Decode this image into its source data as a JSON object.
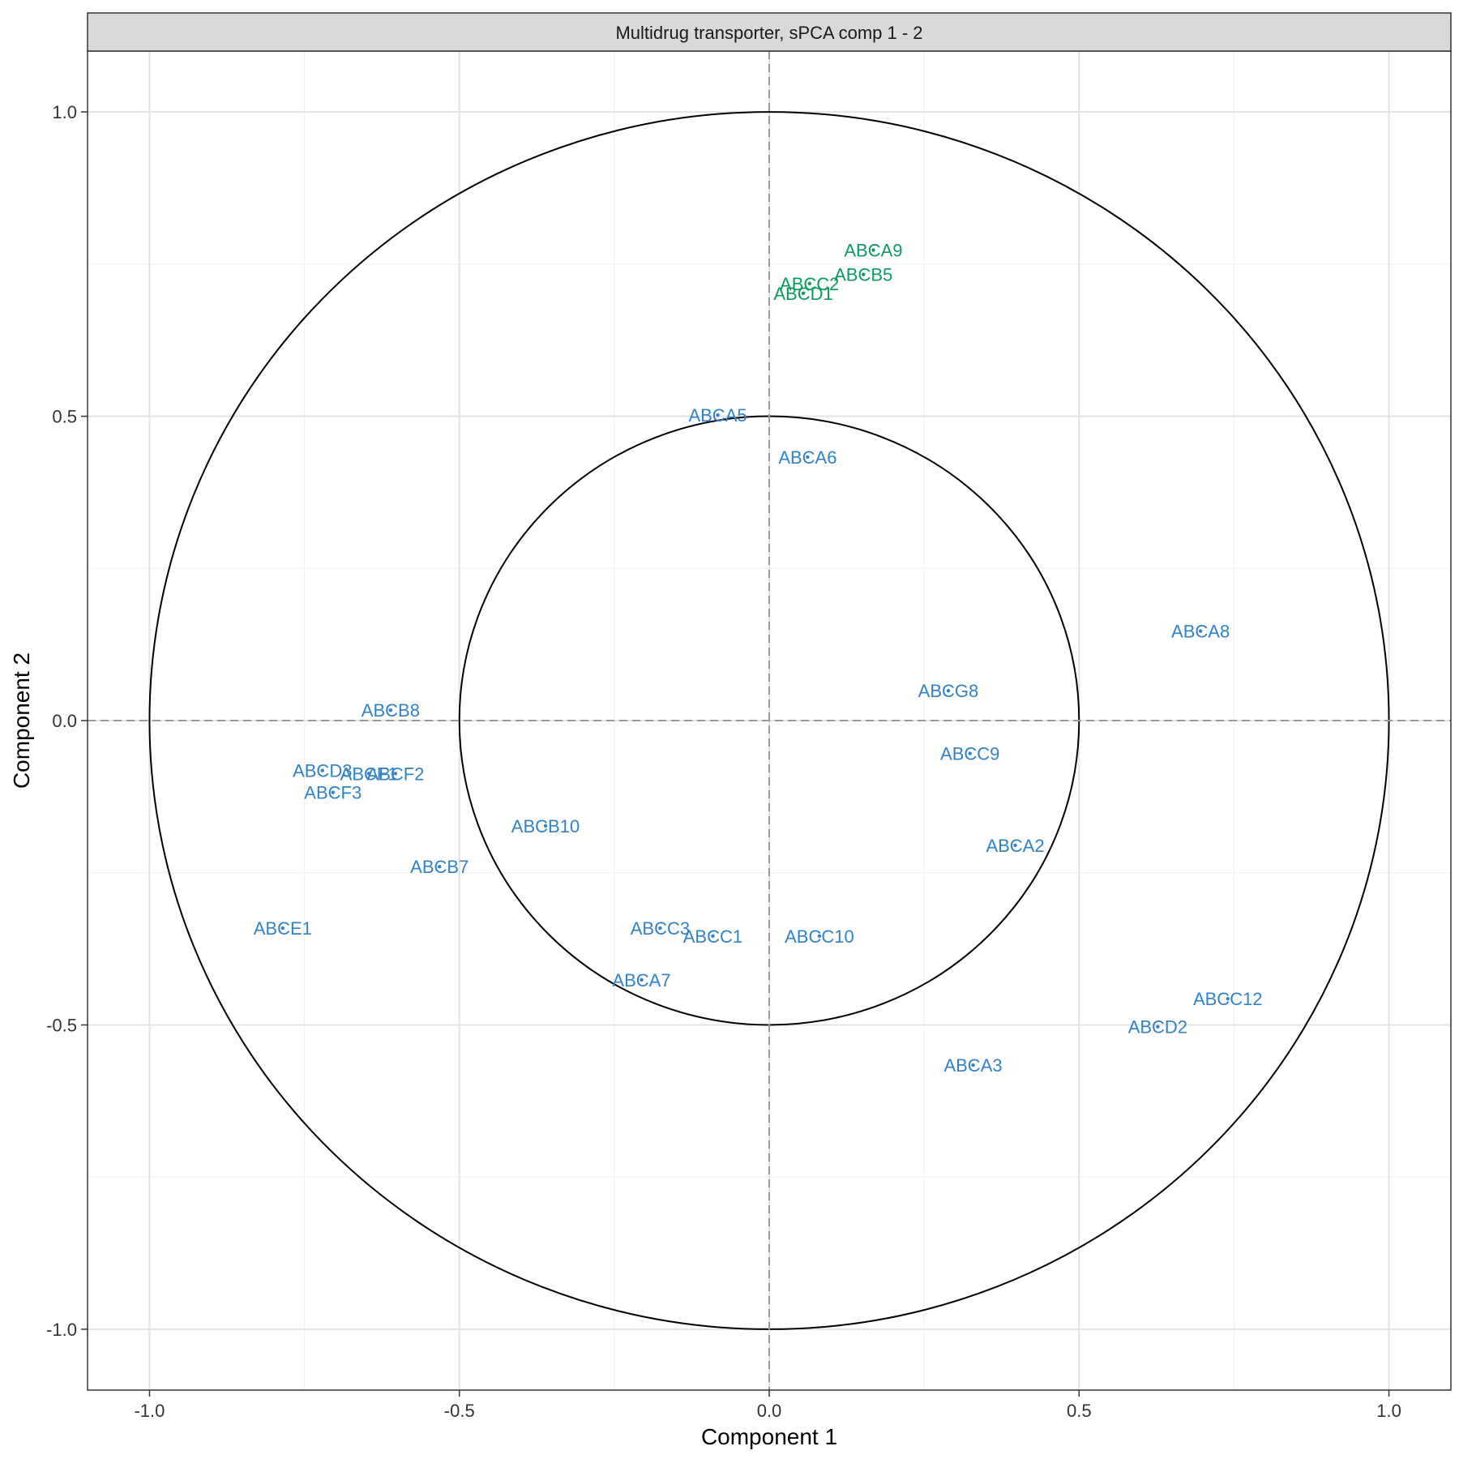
{
  "chart_data": {
    "type": "scatter",
    "title": "Multidrug transporter, sPCA comp 1 - 2",
    "xlabel": "Component  1",
    "ylabel": "Component  2",
    "xlim": [
      -1.1,
      1.1
    ],
    "ylim": [
      -1.1,
      1.1
    ],
    "x_ticks": [
      -1.0,
      -0.5,
      0.0,
      0.5,
      1.0
    ],
    "y_ticks": [
      -1.0,
      -0.5,
      0.0,
      0.5,
      1.0
    ],
    "x_tick_labels": [
      "-1.0",
      "-0.5",
      "0.0",
      "0.5",
      "1.0"
    ],
    "y_tick_labels": [
      "-1.0",
      "-0.5",
      "0.0",
      "0.5",
      "1.0"
    ],
    "grid": true,
    "circles": [
      1.0,
      0.5
    ],
    "reference_lines": {
      "x": 0,
      "y": 0,
      "style": "dashed"
    },
    "colors": {
      "blue": "#3282c8",
      "green": "#0e9a5e"
    },
    "points": [
      {
        "label": "ABCA9",
        "x": 0.168,
        "y": 0.773,
        "color": "green"
      },
      {
        "label": "ABCB5",
        "x": 0.152,
        "y": 0.733,
        "color": "green"
      },
      {
        "label": "ABCC2",
        "x": 0.065,
        "y": 0.718,
        "color": "green"
      },
      {
        "label": "ABCD1",
        "x": 0.055,
        "y": 0.702,
        "color": "green"
      },
      {
        "label": "ABCA5",
        "x": -0.083,
        "y": 0.502,
        "color": "blue"
      },
      {
        "label": "ABCA6",
        "x": 0.062,
        "y": 0.433,
        "color": "blue"
      },
      {
        "label": "ABCA8",
        "x": 0.696,
        "y": 0.147,
        "color": "blue"
      },
      {
        "label": "ABCG8",
        "x": 0.289,
        "y": 0.049,
        "color": "blue"
      },
      {
        "label": "ABCB8",
        "x": -0.611,
        "y": 0.017,
        "color": "blue"
      },
      {
        "label": "ABCC9",
        "x": 0.324,
        "y": -0.054,
        "color": "blue"
      },
      {
        "label": "ABCD3",
        "x": -0.721,
        "y": -0.082,
        "color": "blue"
      },
      {
        "label": "ABCF1",
        "x": -0.646,
        "y": -0.087,
        "color": "blue"
      },
      {
        "label": "ABCF2",
        "x": -0.603,
        "y": -0.087,
        "color": "blue"
      },
      {
        "label": "ABCF3",
        "x": -0.704,
        "y": -0.118,
        "color": "blue"
      },
      {
        "label": "ABCB10",
        "x": -0.361,
        "y": -0.173,
        "color": "blue"
      },
      {
        "label": "ABCA2",
        "x": 0.397,
        "y": -0.205,
        "color": "blue"
      },
      {
        "label": "ABCB7",
        "x": -0.532,
        "y": -0.24,
        "color": "blue"
      },
      {
        "label": "ABCE1",
        "x": -0.785,
        "y": -0.341,
        "color": "blue"
      },
      {
        "label": "ABCC3",
        "x": -0.176,
        "y": -0.341,
        "color": "blue"
      },
      {
        "label": "ABCC1",
        "x": -0.091,
        "y": -0.354,
        "color": "blue"
      },
      {
        "label": "ABCC10",
        "x": 0.081,
        "y": -0.354,
        "color": "blue"
      },
      {
        "label": "ABCA7",
        "x": -0.206,
        "y": -0.426,
        "color": "blue"
      },
      {
        "label": "ABCC12",
        "x": 0.74,
        "y": -0.457,
        "color": "blue"
      },
      {
        "label": "ABCD2",
        "x": 0.627,
        "y": -0.503,
        "color": "blue"
      },
      {
        "label": "ABCA3",
        "x": 0.329,
        "y": -0.566,
        "color": "blue"
      }
    ]
  }
}
